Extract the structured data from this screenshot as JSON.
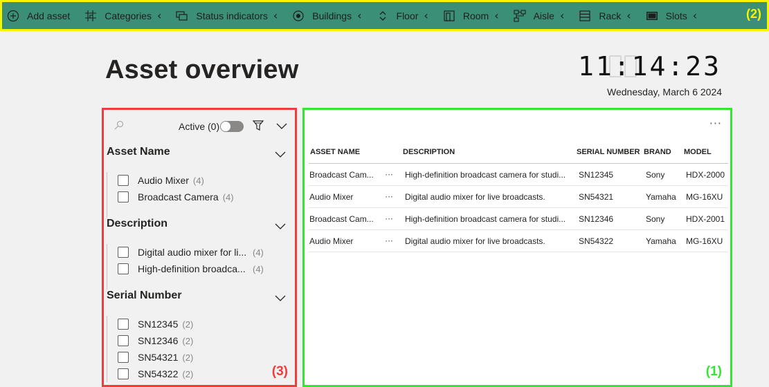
{
  "toolbar": {
    "items": [
      {
        "label": "Add asset",
        "icon": "add-circle-icon",
        "has_chevron": false
      },
      {
        "label": "Categories",
        "icon": "categories-icon",
        "has_chevron": true
      },
      {
        "label": "Status indicators",
        "icon": "status-icon",
        "has_chevron": true
      },
      {
        "label": "Buildings",
        "icon": "target-icon",
        "has_chevron": true
      },
      {
        "label": "Floor",
        "icon": "updown-icon",
        "has_chevron": true
      },
      {
        "label": "Room",
        "icon": "room-icon",
        "has_chevron": true
      },
      {
        "label": "Aisle",
        "icon": "aisle-icon",
        "has_chevron": true
      },
      {
        "label": "Rack",
        "icon": "rack-icon",
        "has_chevron": true
      },
      {
        "label": "Slots",
        "icon": "slots-icon",
        "has_chevron": true
      }
    ],
    "badge": "(2)",
    "badge_color": "#f5f500",
    "background": "#3b8f76"
  },
  "page_title": "Asset overview",
  "clock": {
    "time": "11:14:23",
    "date": "Wednesday, March 6 2024"
  },
  "filter_panel": {
    "active_label": "Active (0)",
    "sections": [
      {
        "title": "Asset Name",
        "items": [
          {
            "label": "Audio Mixer",
            "count": "(4)"
          },
          {
            "label": "Broadcast Camera",
            "count": "(4)"
          }
        ]
      },
      {
        "title": "Description",
        "items": [
          {
            "label": "Digital audio mixer for li...",
            "count": "(4)"
          },
          {
            "label": "High-definition broadca...",
            "count": "(4)"
          }
        ]
      },
      {
        "title": "Serial Number",
        "items": [
          {
            "label": "SN12345",
            "count": "(2)"
          },
          {
            "label": "SN12346",
            "count": "(2)"
          },
          {
            "label": "SN54321",
            "count": "(2)"
          },
          {
            "label": "SN54322",
            "count": "(2)"
          }
        ]
      }
    ],
    "badge": "(3)",
    "badge_color": "#f03c3c"
  },
  "table_panel": {
    "more_label": "···",
    "columns": [
      "ASSET NAME",
      "DESCRIPTION",
      "SERIAL NUMBER",
      "BRAND",
      "MODEL"
    ],
    "rows": [
      {
        "name": "Broadcast Cam...",
        "dots": "···",
        "description": "High-definition broadcast camera for studi...",
        "serial": "SN12345",
        "brand": "Sony",
        "model": "HDX-2000"
      },
      {
        "name": "Audio Mixer",
        "dots": "···",
        "description": "Digital audio mixer for live broadcasts.",
        "serial": "SN54321",
        "brand": "Yamaha",
        "model": "MG-16XU"
      },
      {
        "name": "Broadcast Cam...",
        "dots": "···",
        "description": "High-definition broadcast camera for studi...",
        "serial": "SN12346",
        "brand": "Sony",
        "model": "HDX-2001"
      },
      {
        "name": "Audio Mixer",
        "dots": "···",
        "description": "Digital audio mixer for live broadcasts.",
        "serial": "SN54322",
        "brand": "Yamaha",
        "model": "MG-16XU"
      }
    ],
    "badge": "(1)",
    "badge_color": "#32e632"
  }
}
